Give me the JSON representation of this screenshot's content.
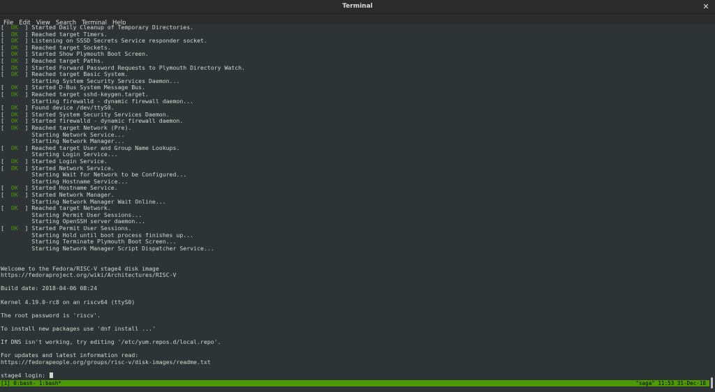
{
  "window": {
    "title": "Terminal",
    "close_icon": "close-icon"
  },
  "menu": [
    "File",
    "Edit",
    "View",
    "Search",
    "Terminal",
    "Help"
  ],
  "colors": {
    "background": "#2e3436",
    "text": "#d3d7cf",
    "ok": "#4e9a06",
    "statusbar": "#4e9a06"
  },
  "boot_log": [
    {
      "ok": true,
      "text": "Started Daily Cleanup of Temporary Directories."
    },
    {
      "ok": true,
      "text": "Reached target Timers."
    },
    {
      "ok": true,
      "text": "Listening on SSSD Secrets Service responder socket."
    },
    {
      "ok": true,
      "text": "Reached target Sockets."
    },
    {
      "ok": true,
      "text": "Started Show Plymouth Boot Screen."
    },
    {
      "ok": true,
      "text": "Reached target Paths."
    },
    {
      "ok": true,
      "text": "Started Forward Password Requests to Plymouth Directory Watch."
    },
    {
      "ok": true,
      "text": "Reached target Basic System."
    },
    {
      "ok": false,
      "text": "Starting System Security Services Daemon..."
    },
    {
      "ok": true,
      "text": "Started D-Bus System Message Bus."
    },
    {
      "ok": true,
      "text": "Reached target sshd-keygen.target."
    },
    {
      "ok": false,
      "text": "Starting firewalld - dynamic firewall daemon..."
    },
    {
      "ok": true,
      "text": "Found device /dev/ttyS0."
    },
    {
      "ok": true,
      "text": "Started System Security Services Daemon."
    },
    {
      "ok": true,
      "text": "Started firewalld - dynamic firewall daemon."
    },
    {
      "ok": true,
      "text": "Reached target Network (Pre)."
    },
    {
      "ok": false,
      "text": "Starting Network Service..."
    },
    {
      "ok": false,
      "text": "Starting Network Manager..."
    },
    {
      "ok": true,
      "text": "Reached target User and Group Name Lookups."
    },
    {
      "ok": false,
      "text": "Starting Login Service..."
    },
    {
      "ok": true,
      "text": "Started Login Service."
    },
    {
      "ok": true,
      "text": "Started Network Service."
    },
    {
      "ok": false,
      "text": "Starting Wait for Network to be Configured..."
    },
    {
      "ok": false,
      "text": "Starting Hostname Service..."
    },
    {
      "ok": true,
      "text": "Started Hostname Service."
    },
    {
      "ok": true,
      "text": "Started Network Manager."
    },
    {
      "ok": false,
      "text": "Starting Network Manager Wait Online..."
    },
    {
      "ok": true,
      "text": "Reached target Network."
    },
    {
      "ok": false,
      "text": "Starting Permit User Sessions..."
    },
    {
      "ok": false,
      "text": "Starting OpenSSH server daemon..."
    },
    {
      "ok": true,
      "text": "Started Permit User Sessions."
    },
    {
      "ok": false,
      "text": "Starting Hold until boot process finishes up..."
    },
    {
      "ok": false,
      "text": "Starting Terminate Plymouth Boot Screen..."
    },
    {
      "ok": false,
      "text": "Starting Network Manager Script Dispatcher Service..."
    }
  ],
  "ok_label": "OK",
  "welcome": [
    "",
    "",
    "Welcome to the Fedora/RISC-V stage4 disk image",
    "https://fedoraproject.org/wiki/Architectures/RISC-V",
    "",
    "Build date: 2018-04-06 08:24",
    "",
    "Kernel 4.19.0-rc8 on an riscv64 (ttyS0)",
    "",
    "The root password is 'riscv'.",
    "",
    "To install new packages use 'dnf install ...'",
    "",
    "If DNS isn't working, try editing '/etc/yum.repos.d/local.repo'.",
    "",
    "For updates and latest information read:",
    "https://fedorapeople.org/groups/risc-v/disk-images/readme.txt",
    ""
  ],
  "prompt": "stage4 login: ",
  "status": {
    "left": "[1] 0:bash- 1:bash*",
    "right": "\"saga\" 11:53 31-Dec-18"
  }
}
